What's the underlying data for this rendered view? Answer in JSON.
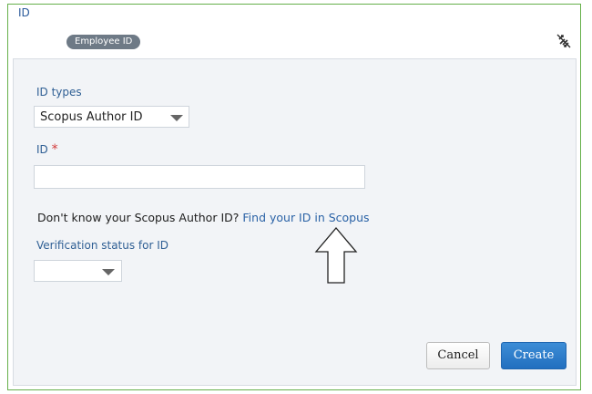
{
  "header": {
    "title": "ID",
    "badge": "Employee ID"
  },
  "form": {
    "id_types_label": "ID types",
    "id_type_value": "Scopus Author ID",
    "id_label": "ID",
    "id_required_mark": "*",
    "id_value": "",
    "help_text": "Don't know your Scopus Author ID?",
    "help_link": "Find your ID in Scopus",
    "verification_label": "Verification status for ID",
    "verification_value": ""
  },
  "actions": {
    "cancel_label": "Cancel",
    "create_label": "Create"
  },
  "icons": {
    "unlink": "unlink-icon",
    "arrow": "up-arrow-icon"
  },
  "colors": {
    "frame_border": "#66b04a",
    "link": "#2a62a6",
    "primary": "#2672c2"
  }
}
